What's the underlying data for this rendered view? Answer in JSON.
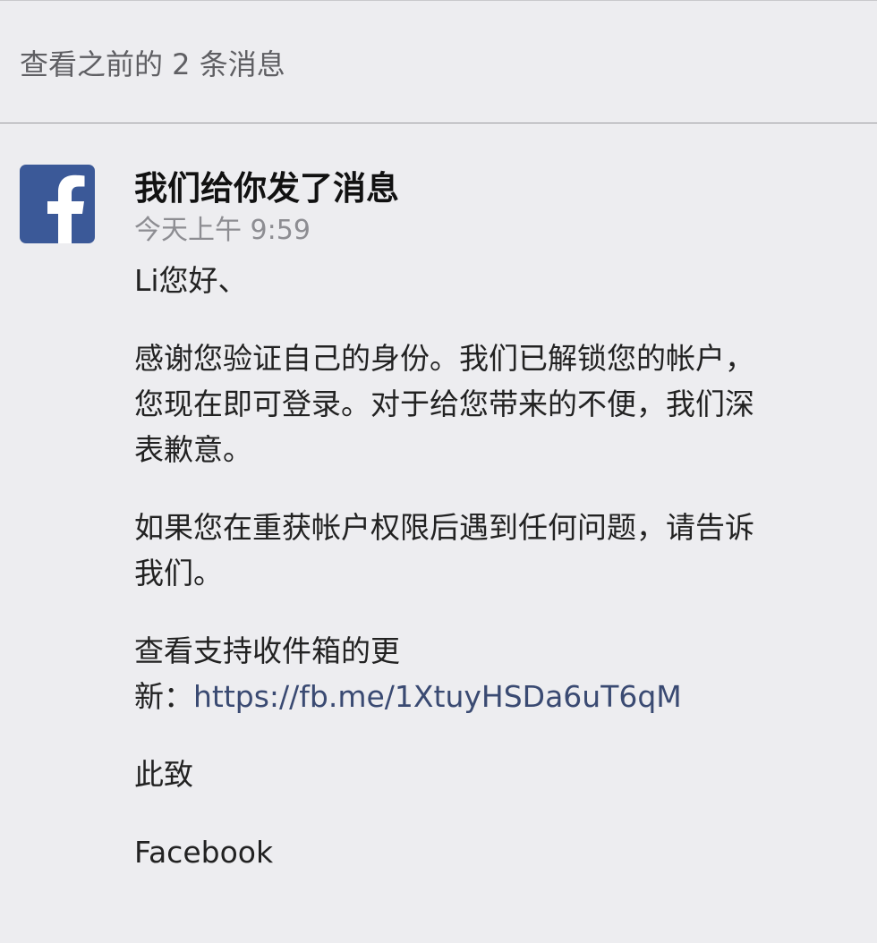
{
  "header": {
    "view_previous": "查看之前的 2 条消息"
  },
  "message": {
    "sender_icon": "facebook-logo-icon",
    "brand_color": "#3b5998",
    "title": "我们给你发了消息",
    "timestamp": "今天上午 9:59",
    "greeting": "Li您好、",
    "paragraph1_line1": "感谢您验证自己的身份。我们已解锁您的帐户，",
    "paragraph1_line2": "您现在即可登录。对于给您带来的不便，我们深",
    "paragraph1_line3": "表歉意。",
    "paragraph2_line1": "如果您在重获帐户权限后遇到任何问题，请告诉",
    "paragraph2_line2": "我们。",
    "paragraph3_line1": "查看支持收件箱的更",
    "paragraph3_prefix": "新：",
    "support_link": "https://fb.me/1XtuyHSDa6uT6qM",
    "closing": "此致",
    "signature": "Facebook"
  }
}
